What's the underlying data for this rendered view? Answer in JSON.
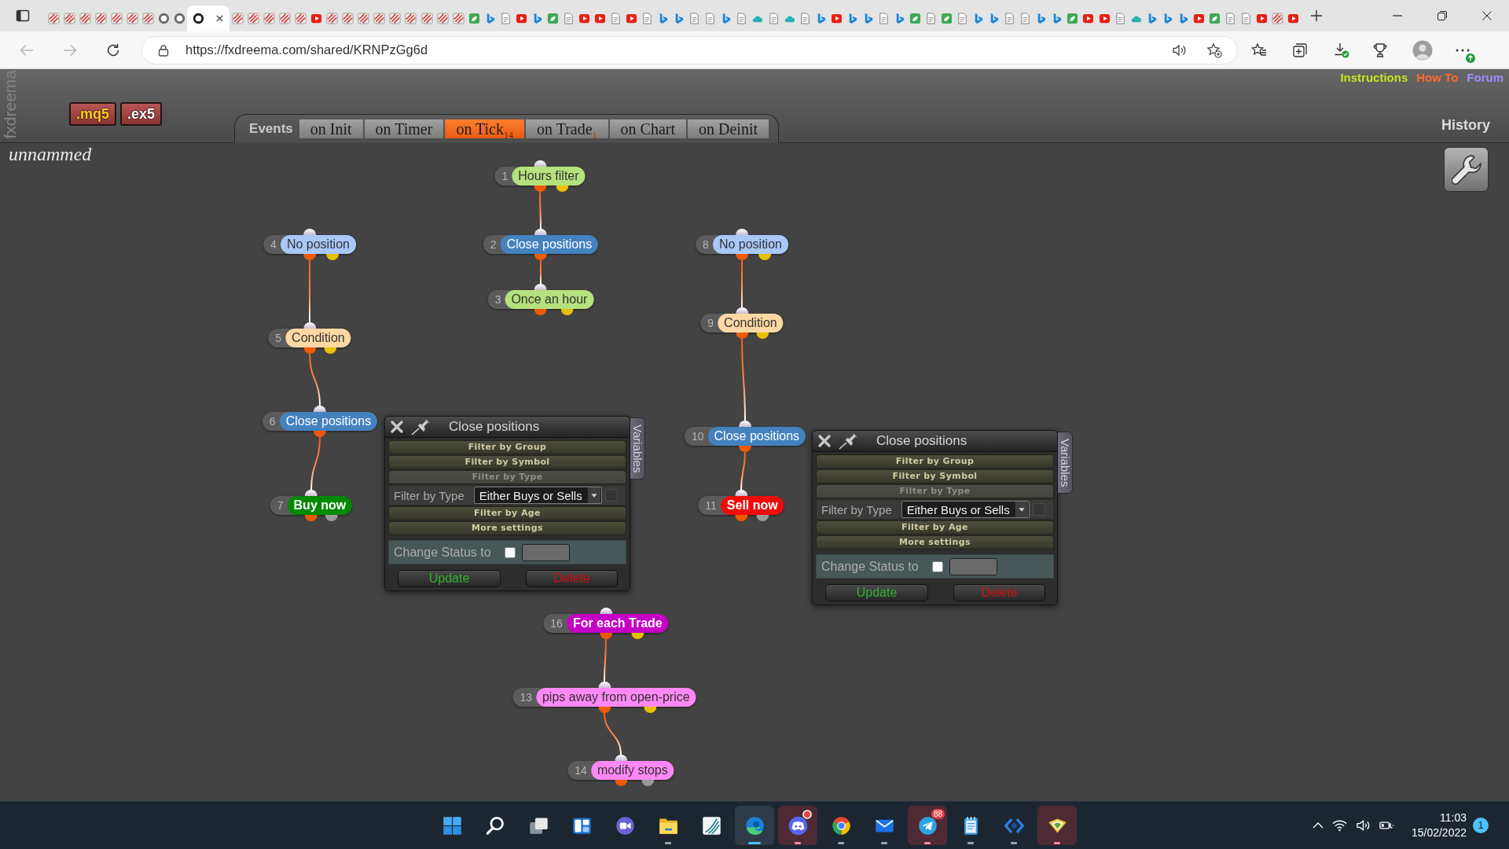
{
  "browser": {
    "tabs": [
      {
        "kind": "slash",
        "selected": false
      },
      {
        "kind": "slash",
        "selected": false
      },
      {
        "kind": "slash",
        "selected": false
      },
      {
        "kind": "slash",
        "selected": false
      },
      {
        "kind": "slash",
        "selected": false
      },
      {
        "kind": "slash",
        "selected": false
      },
      {
        "kind": "slash",
        "selected": false
      },
      {
        "kind": "ring",
        "selected": false
      },
      {
        "kind": "ring",
        "selected": false
      },
      {
        "kind": "ring",
        "selected": true
      },
      {
        "kind": "slash",
        "selected": false
      },
      {
        "kind": "slash",
        "selected": false
      },
      {
        "kind": "slash",
        "selected": false
      },
      {
        "kind": "slash",
        "selected": false
      },
      {
        "kind": "slash",
        "selected": false
      },
      {
        "kind": "play",
        "selected": false
      },
      {
        "kind": "slash",
        "selected": false
      },
      {
        "kind": "slash",
        "selected": false
      },
      {
        "kind": "slash",
        "selected": false
      },
      {
        "kind": "slash",
        "selected": false
      },
      {
        "kind": "slash",
        "selected": false
      },
      {
        "kind": "slash",
        "selected": false
      },
      {
        "kind": "slash",
        "selected": false
      },
      {
        "kind": "slash",
        "selected": false
      },
      {
        "kind": "slash",
        "selected": false
      },
      {
        "kind": "leaf",
        "selected": false
      },
      {
        "kind": "bing",
        "selected": false
      },
      {
        "kind": "page",
        "selected": false
      },
      {
        "kind": "play",
        "selected": false
      },
      {
        "kind": "bing",
        "selected": false
      },
      {
        "kind": "leaf",
        "selected": false
      },
      {
        "kind": "page",
        "selected": false
      },
      {
        "kind": "play",
        "selected": false
      },
      {
        "kind": "play",
        "selected": false
      },
      {
        "kind": "page",
        "selected": false
      },
      {
        "kind": "play",
        "selected": false
      },
      {
        "kind": "page",
        "selected": false
      },
      {
        "kind": "bing",
        "selected": false
      },
      {
        "kind": "bing",
        "selected": false
      },
      {
        "kind": "page",
        "selected": false
      },
      {
        "kind": "page",
        "selected": false
      },
      {
        "kind": "bing",
        "selected": false
      },
      {
        "kind": "page",
        "selected": false
      },
      {
        "kind": "cloud",
        "selected": false
      },
      {
        "kind": "page",
        "selected": false
      },
      {
        "kind": "cloud",
        "selected": false
      },
      {
        "kind": "page",
        "selected": false
      },
      {
        "kind": "bing",
        "selected": false
      },
      {
        "kind": "play",
        "selected": false
      },
      {
        "kind": "bing",
        "selected": false
      },
      {
        "kind": "bing",
        "selected": false
      },
      {
        "kind": "page",
        "selected": false
      },
      {
        "kind": "bing",
        "selected": false
      },
      {
        "kind": "leaf",
        "selected": false
      },
      {
        "kind": "page",
        "selected": false
      },
      {
        "kind": "leaf",
        "selected": false
      },
      {
        "kind": "page",
        "selected": false
      },
      {
        "kind": "bing",
        "selected": false
      },
      {
        "kind": "bing",
        "selected": false
      },
      {
        "kind": "page",
        "selected": false
      },
      {
        "kind": "page",
        "selected": false
      },
      {
        "kind": "bing",
        "selected": false
      },
      {
        "kind": "bing",
        "selected": false
      },
      {
        "kind": "leaf",
        "selected": false
      },
      {
        "kind": "play",
        "selected": false
      },
      {
        "kind": "play",
        "selected": false
      },
      {
        "kind": "page",
        "selected": false
      },
      {
        "kind": "cloud",
        "selected": false
      },
      {
        "kind": "bing",
        "selected": false
      },
      {
        "kind": "bing",
        "selected": false
      },
      {
        "kind": "bing",
        "selected": false
      },
      {
        "kind": "play",
        "selected": false
      },
      {
        "kind": "leaf",
        "selected": false
      },
      {
        "kind": "page",
        "selected": false
      },
      {
        "kind": "page",
        "selected": false
      },
      {
        "kind": "play",
        "selected": false
      },
      {
        "kind": "slash",
        "selected": false
      },
      {
        "kind": "play",
        "selected": false
      }
    ],
    "address": "https://fxdreema.com/shared/KRNPzGg6d"
  },
  "app": {
    "brand": "fxdreema",
    "export_buttons": [
      {
        "label": ".mq5",
        "kind": "source"
      },
      {
        "label": ".ex5",
        "kind": "compiled"
      }
    ],
    "events": {
      "label": "Events",
      "tabs": [
        {
          "label": "on Init",
          "selected": false
        },
        {
          "label": "on Timer",
          "selected": false
        },
        {
          "label": "on Tick",
          "count": "14",
          "selected": true
        },
        {
          "label": "on Trade",
          "count": "1",
          "selected": false
        },
        {
          "label": "on Chart",
          "selected": false
        },
        {
          "label": "on Deinit",
          "selected": false
        }
      ]
    },
    "links": [
      {
        "label": "Instructions",
        "color": "#c6e41e"
      },
      {
        "label": "How To",
        "color": "#ff6a2a"
      },
      {
        "label": "Forum",
        "color": "#9b8cff"
      }
    ],
    "history": "History",
    "project_name": "unnammed"
  },
  "canvas": {
    "blocks": [
      {
        "number": "1",
        "label": "Hours filter",
        "kind": "condition",
        "color": "#b4e27c",
        "children": [
          {
            "number": "2",
            "label": "Close positions",
            "kind": "action",
            "color": "#4381bf",
            "children": [
              {
                "number": "3",
                "label": "Once an hour",
                "kind": "condition",
                "color": "#b4e27c"
              }
            ]
          }
        ]
      },
      {
        "number": "4",
        "label": "No position",
        "kind": "condition",
        "color": "#a8c8f8",
        "children": [
          {
            "number": "5",
            "label": "Condition",
            "kind": "condition",
            "color": "#fdd8a4",
            "children": [
              {
                "number": "6",
                "label": "Close positions",
                "kind": "action",
                "color": "#4381bf",
                "children": [
                  {
                    "number": "7",
                    "label": "Buy now",
                    "kind": "trade",
                    "color": "#008a00"
                  }
                ]
              }
            ]
          }
        ]
      },
      {
        "number": "8",
        "label": "No position",
        "kind": "condition",
        "color": "#a8c8f8",
        "children": [
          {
            "number": "9",
            "label": "Condition",
            "kind": "condition",
            "color": "#fdd8a4",
            "children": [
              {
                "number": "10",
                "label": "Close positions",
                "kind": "action",
                "color": "#4381bf",
                "children": [
                  {
                    "number": "11",
                    "label": "Sell now",
                    "kind": "trade",
                    "color": "#f00a0a"
                  }
                ]
              }
            ]
          }
        ]
      },
      {
        "number": "16",
        "label": "For each Trade",
        "kind": "loop",
        "color": "#c400c4",
        "children": [
          {
            "number": "13",
            "label": "pips away from open-price",
            "kind": "condition",
            "color": "#ff88f6",
            "children": [
              {
                "number": "14",
                "label": "modify stops",
                "kind": "modify",
                "color": "#ff88f6"
              }
            ]
          }
        ]
      }
    ],
    "panels": [
      {
        "title": "Close positions",
        "sections": [
          {
            "label": "Filter by Group",
            "expanded": false
          },
          {
            "label": "Filter by Symbol",
            "expanded": false
          },
          {
            "label": "Filter by Type",
            "expanded": true,
            "fields": [
              {
                "label": "Filter by Type",
                "value": "Either Buys or Sells"
              }
            ]
          },
          {
            "label": "Filter by Age",
            "expanded": false
          },
          {
            "label": "More settings",
            "expanded": false
          }
        ],
        "status": {
          "label": "Change Status to",
          "checked": false
        },
        "buttons": [
          {
            "label": "Update",
            "kind": "update"
          },
          {
            "label": "Delete",
            "kind": "delete"
          }
        ],
        "side_tab": "Variables"
      },
      {
        "title": "Close positions",
        "sections": [
          {
            "label": "Filter by Group",
            "expanded": false
          },
          {
            "label": "Filter by Symbol",
            "expanded": false
          },
          {
            "label": "Filter by Type",
            "expanded": true,
            "fields": [
              {
                "label": "Filter by Type",
                "value": "Either Buys or Sells"
              }
            ]
          },
          {
            "label": "Filter by Age",
            "expanded": false
          },
          {
            "label": "More settings",
            "expanded": false
          }
        ],
        "status": {
          "label": "Change Status to",
          "checked": false
        },
        "buttons": [
          {
            "label": "Update",
            "kind": "update"
          },
          {
            "label": "Delete",
            "kind": "delete"
          }
        ],
        "side_tab": "Variables"
      }
    ]
  },
  "taskbar": {
    "apps": [
      {
        "running": false,
        "selected": false,
        "flashing": false,
        "unread": false
      },
      {
        "running": false,
        "selected": false,
        "flashing": false,
        "unread": false
      },
      {
        "running": false,
        "selected": false,
        "flashing": false,
        "unread": false
      },
      {
        "running": false,
        "selected": false,
        "flashing": false,
        "unread": false
      },
      {
        "running": false,
        "selected": false,
        "flashing": false,
        "unread": false
      },
      {
        "running": true,
        "selected": false,
        "flashing": false,
        "unread": false
      },
      {
        "running": false,
        "selected": false,
        "flashing": false,
        "unread": false
      },
      {
        "running": true,
        "selected": true,
        "flashing": false,
        "unread": false
      },
      {
        "running": true,
        "selected": false,
        "flashing": true,
        "unread": true
      },
      {
        "running": true,
        "selected": false,
        "flashing": false,
        "unread": false
      },
      {
        "running": true,
        "selected": false,
        "flashing": false,
        "unread": false
      },
      {
        "running": true,
        "selected": false,
        "flashing": true,
        "unread": false,
        "badge": "88"
      },
      {
        "running": true,
        "selected": false,
        "flashing": false,
        "unread": false
      },
      {
        "running": true,
        "selected": false,
        "flashing": false,
        "unread": false
      },
      {
        "running": true,
        "selected": false,
        "flashing": true,
        "unread": false
      }
    ],
    "time": "11:03",
    "date": "15/02/2022",
    "notification_count": "1"
  }
}
